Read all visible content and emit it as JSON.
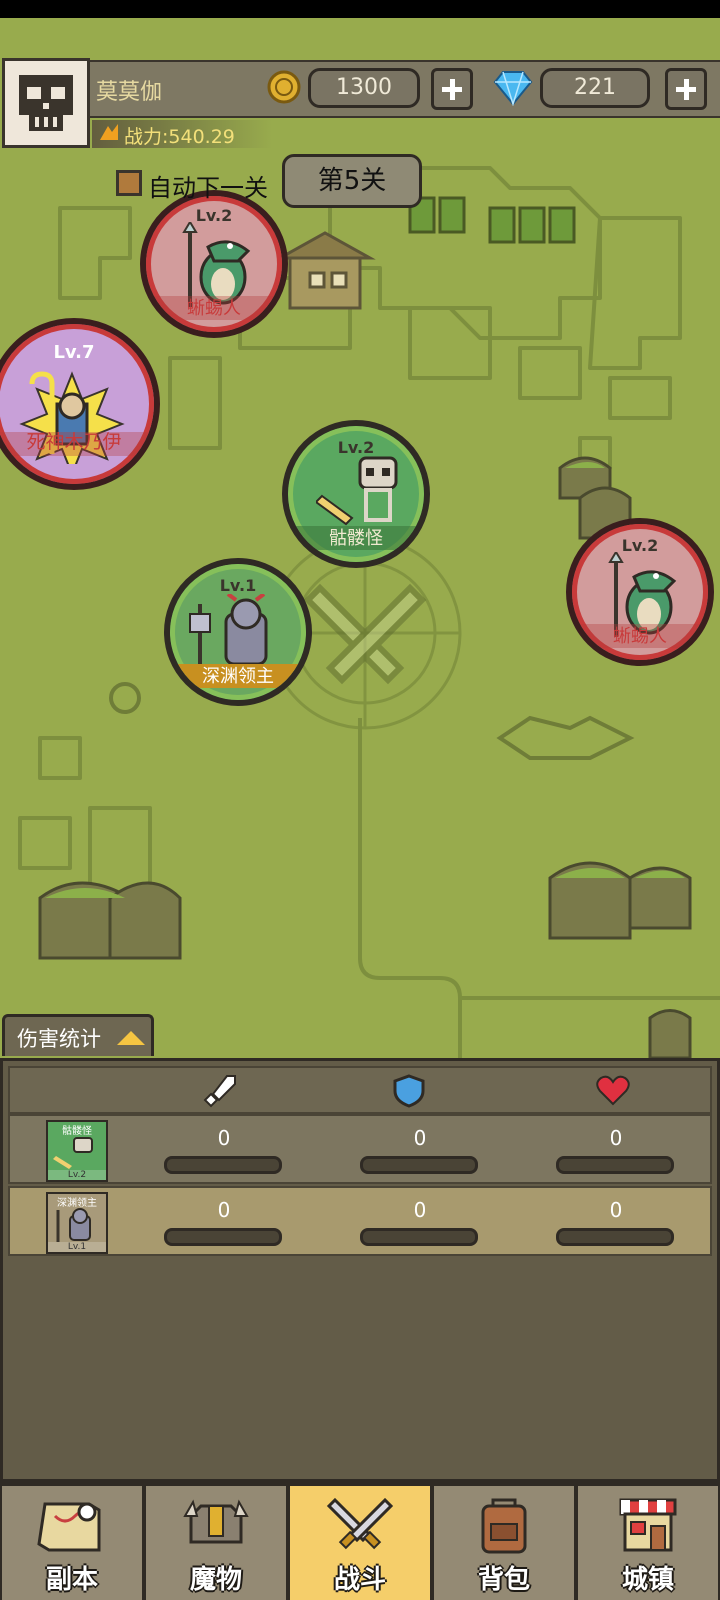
{
  "player": {
    "name": "莫莫伽",
    "power": "战力:540.29"
  },
  "currency": {
    "coins": "1300",
    "gems": "221"
  },
  "stage": {
    "auto_next_label": "自动下一关",
    "auto_next_checked": true,
    "current": "第5关"
  },
  "monsters": [
    {
      "id": "lizardman-1",
      "level": "Lv.2",
      "name": "蜥蜴人",
      "side": "enemy"
    },
    {
      "id": "mummy",
      "level": "Lv.7",
      "name": "死神木乃伊",
      "side": "enemy"
    },
    {
      "id": "skeleton",
      "level": "Lv.2",
      "name": "骷髅怪",
      "side": "ally"
    },
    {
      "id": "abyss-lord",
      "level": "Lv.1",
      "name": "深渊领主",
      "side": "ally"
    },
    {
      "id": "lizardman-2",
      "level": "Lv.2",
      "name": "蜥蜴人",
      "side": "enemy"
    }
  ],
  "damage_stats": {
    "tab_label": "伤害统计",
    "columns": [
      "attack-icon",
      "defense-icon",
      "health-icon"
    ],
    "rows": [
      {
        "name": "骷髅怪",
        "level": "Lv.2",
        "attack": "0",
        "defense": "0",
        "health": "0"
      },
      {
        "name": "深渊领主",
        "level": "Lv.1",
        "attack": "0",
        "defense": "0",
        "health": "0"
      }
    ]
  },
  "nav": {
    "tabs": [
      {
        "label": "副本",
        "icon": "map-scroll-icon"
      },
      {
        "label": "魔物",
        "icon": "monster-helmet-icon"
      },
      {
        "label": "战斗",
        "icon": "crossed-swords-icon",
        "active": true
      },
      {
        "label": "背包",
        "icon": "backpack-icon"
      },
      {
        "label": "城镇",
        "icon": "town-shop-icon"
      }
    ]
  },
  "colors": {
    "map_bg": "#98ab4d",
    "enemy_ring": "#c83a3a",
    "ally_ring": "#86c05a",
    "active_tab": "#f5ce6a"
  }
}
